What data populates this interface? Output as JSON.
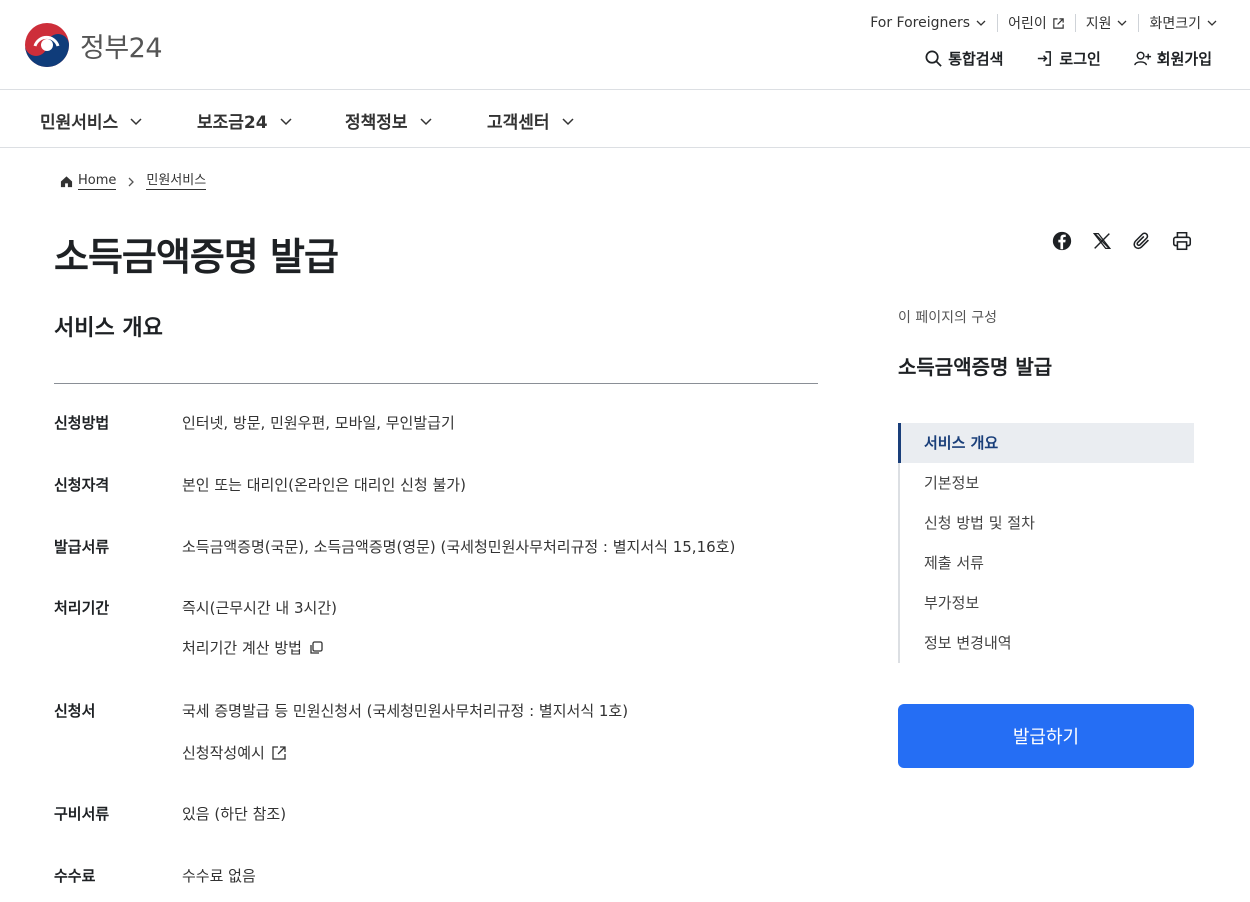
{
  "header": {
    "logo_text": "정부24",
    "utility": [
      {
        "label": "For Foreigners"
      },
      {
        "label": "어린이"
      },
      {
        "label": "지원"
      },
      {
        "label": "화면크기"
      }
    ],
    "actions": {
      "search": "통합검색",
      "login": "로그인",
      "signup": "회원가입"
    }
  },
  "gnb": [
    {
      "label": "민원서비스"
    },
    {
      "label": "보조금24"
    },
    {
      "label": "정책정보"
    },
    {
      "label": "고객센터"
    }
  ],
  "breadcrumb": {
    "home": "Home",
    "current": "민원서비스"
  },
  "page_title": "소득금액증명 발급",
  "main": {
    "section_title": "서비스 개요",
    "rows": [
      {
        "label": "신청방법",
        "value": "인터넷, 방문, 민원우편, 모바일, 무인발급기"
      },
      {
        "label": "신청자격",
        "value": "본인 또는 대리인(온라인은 대리인 신청 불가)"
      },
      {
        "label": "발급서류",
        "value": "소득금액증명(국문), 소득금액증명(영문) (국세청민원사무처리규정 : 별지서식 15,16호)"
      },
      {
        "label": "처리기간",
        "value": "즉시(근무시간 내 3시간)",
        "sub": "처리기간 계산 방법"
      },
      {
        "label": "신청서",
        "value": "국세 증명발급 등 민원신청서 (국세청민원사무처리규정 : 별지서식 1호)",
        "sub": "신청작성예시"
      },
      {
        "label": "구비서류",
        "value": "있음 (하단 참조)"
      },
      {
        "label": "수수료",
        "value": "수수료 없음"
      }
    ]
  },
  "sidebar": {
    "caption": "이 페이지의 구성",
    "title": "소득금액증명 발급",
    "items": [
      {
        "label": "서비스 개요"
      },
      {
        "label": "기본정보"
      },
      {
        "label": "신청 방법 및 절차"
      },
      {
        "label": "제출 서류"
      },
      {
        "label": "부가정보"
      },
      {
        "label": "정보 변경내역"
      }
    ],
    "button": "발급하기"
  },
  "colors": {
    "primary": "#256ef4",
    "toc_active": "#1a3f7a",
    "toc_active_bg": "#eaedf1"
  }
}
